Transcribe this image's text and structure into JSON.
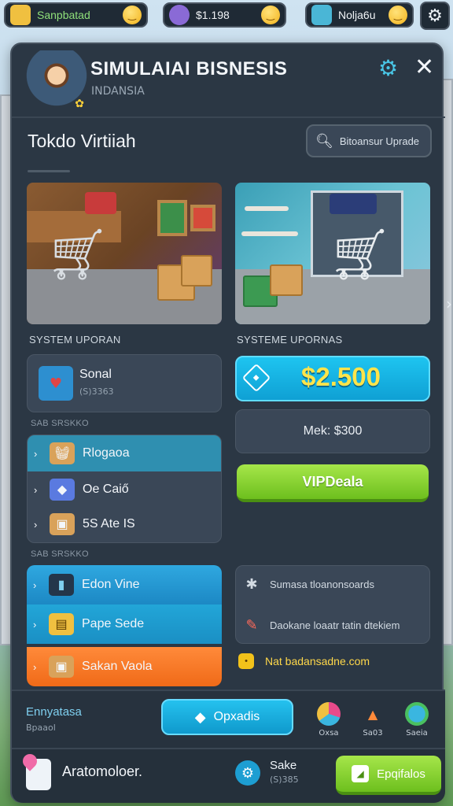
{
  "topbar": {
    "resources": [
      {
        "label": "Sanpbatad",
        "icon": "wallet-icon",
        "color": "#f0c040"
      },
      {
        "label": "$1.198",
        "icon": "gem-icon",
        "color": "#8a6ad6"
      },
      {
        "label": "Nolja6u",
        "icon": "crystal-icon",
        "color": "#4ab6d6"
      }
    ],
    "settings_icon": "gear-icon"
  },
  "header": {
    "title": "SIMULAIAI BISNESIS",
    "subtitle": "INDANSIA"
  },
  "shop": {
    "title": "Tokdo Virtiiah",
    "upgrade_label": "Bitoansur Uprade"
  },
  "sections": {
    "left_scene_label": "SYSTEM UPORAN",
    "right_scene_label": "SYSTEME UPORNAS",
    "sub1": "SAB SRSKKO",
    "sub2": "SAB SRSKKO"
  },
  "social_card": {
    "title": "Sonal",
    "sub": "(S)3363"
  },
  "list1": [
    {
      "label": "Rlogaoa",
      "icon": "basket-icon"
    },
    {
      "label": "Oe Caiő",
      "icon": "gift-icon"
    },
    {
      "label": "5S Ate IS",
      "icon": "box-icon"
    }
  ],
  "list2": [
    {
      "label": "Edon Vine",
      "icon": "tablet-icon"
    },
    {
      "label": "Pape Sede",
      "icon": "package-icon"
    },
    {
      "label": "Sakan Vaola",
      "icon": "crate-icon"
    }
  ],
  "price": {
    "value": "$2.500"
  },
  "max_text": "Mek: $300",
  "green_button": "VIPDeala",
  "info_rows": [
    {
      "text": "Sumasa tloanonsoards",
      "icon": "puzzle-icon"
    },
    {
      "text": "Daokane loaatr tatin dtekiem",
      "icon": "pencil-icon"
    }
  ],
  "link_text": "Nat badansadne.com",
  "footer": {
    "label": "Ennyatasa",
    "sub": "Bpaaol",
    "upgrade_button": "Opxadis",
    "minis": [
      {
        "label": "Oxsa",
        "icon": "pie-icon"
      },
      {
        "label": "Sa03",
        "icon": "carrot-icon"
      },
      {
        "label": "Saeia",
        "icon": "globe-icon"
      }
    ]
  },
  "footer2": {
    "text": "Aratomoloer.",
    "stat_label": "Sake",
    "stat_sub": "(S)385",
    "button": "Epqifalos"
  }
}
